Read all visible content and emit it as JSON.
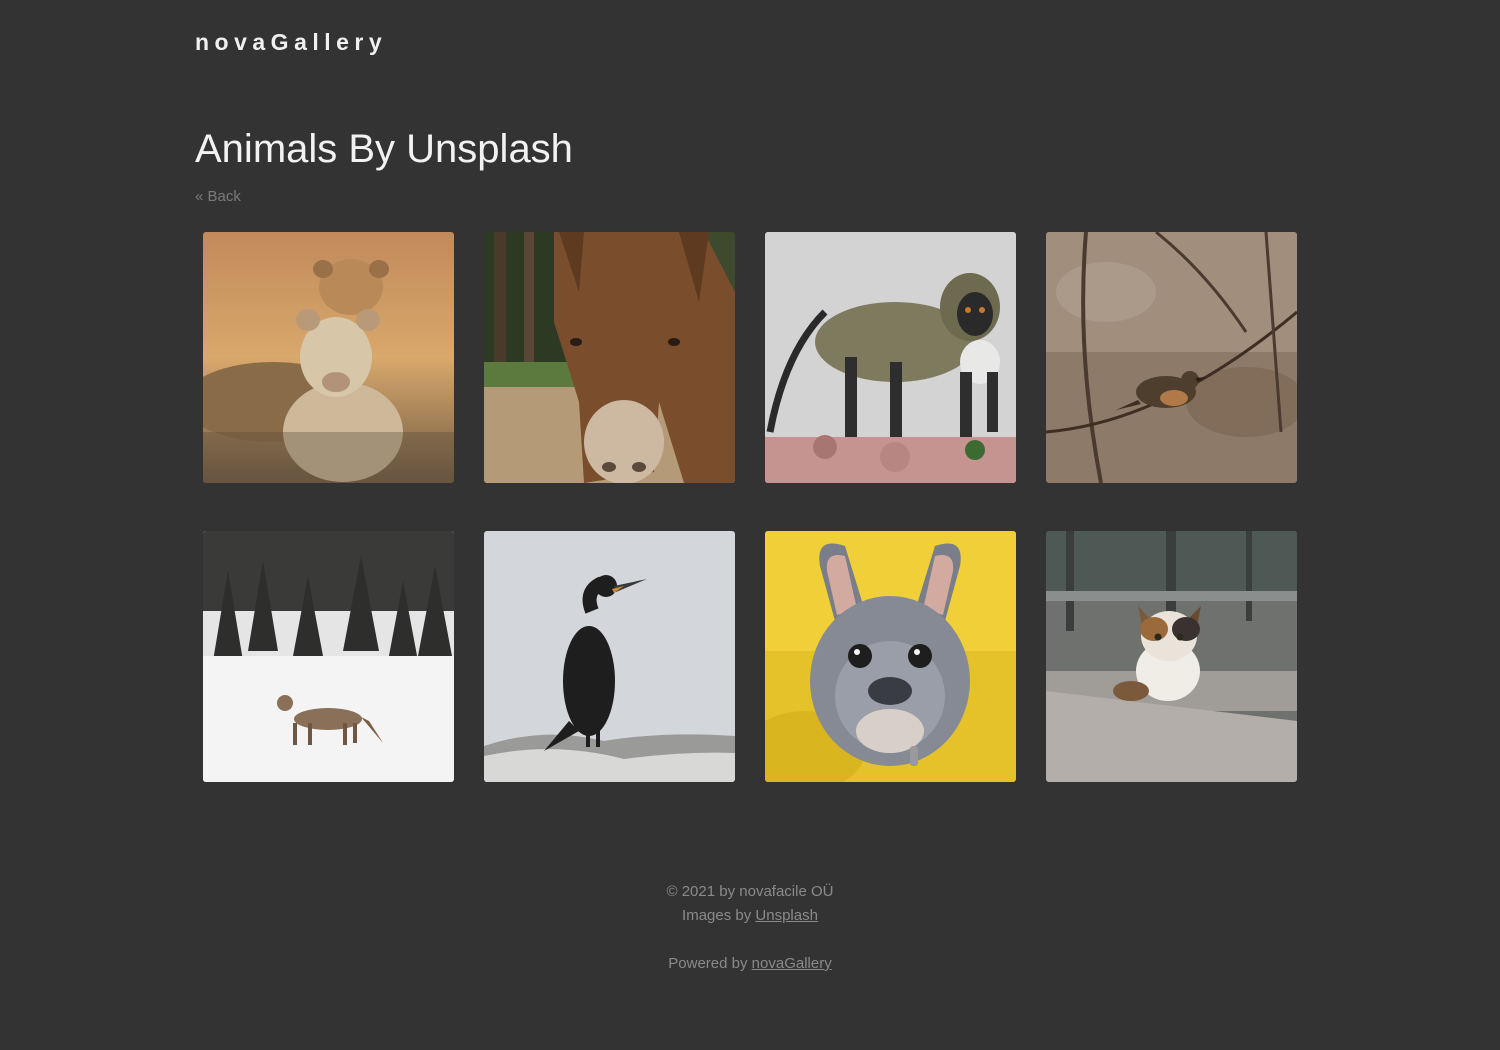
{
  "header": {
    "brand": "novaGallery"
  },
  "page": {
    "title": "Animals By Unsplash",
    "back_link": "« Back"
  },
  "gallery": {
    "images": [
      {
        "subject": "lions",
        "name": "photo-lions"
      },
      {
        "subject": "donkey",
        "name": "photo-donkey"
      },
      {
        "subject": "monkey",
        "name": "photo-monkey"
      },
      {
        "subject": "bird on branch",
        "name": "photo-bird"
      },
      {
        "subject": "coyote in snow",
        "name": "photo-coyote"
      },
      {
        "subject": "cormorant",
        "name": "photo-cormorant"
      },
      {
        "subject": "french bulldog",
        "name": "photo-bulldog"
      },
      {
        "subject": "calico cat",
        "name": "photo-cat"
      }
    ]
  },
  "footer": {
    "copyright": "© 2021 by novafacile OÜ",
    "images_by_prefix": "Images by ",
    "images_by_link": "Unsplash",
    "powered_by_prefix": "Powered by ",
    "powered_by_link": "novaGallery"
  },
  "colors": {
    "background": "#333333",
    "text": "#e6e6e6",
    "muted": "#8a8a8a"
  }
}
